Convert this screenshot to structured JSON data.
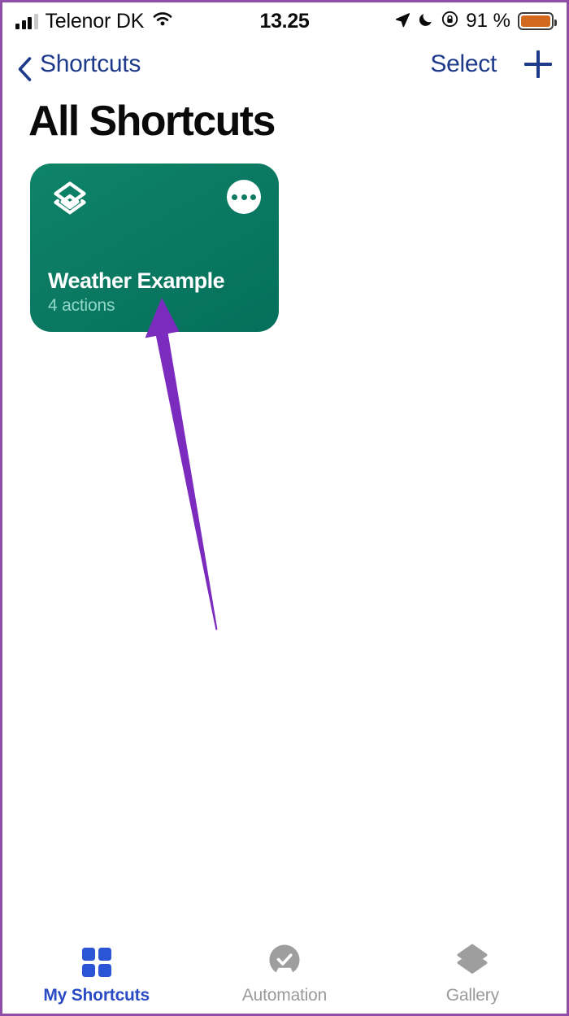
{
  "status_bar": {
    "carrier": "Telenor DK",
    "signal_icon": "cellular-signal-icon",
    "signal_bars_filled": 3,
    "signal_bars_total": 4,
    "wifi_icon": "wifi-icon",
    "time": "13.25",
    "location_icon": "location-arrow-icon",
    "dnd_icon": "moon-do-not-disturb-icon",
    "orientation_lock_icon": "rotation-lock-icon",
    "battery_percent": "91 %",
    "battery_icon": "battery-icon",
    "battery_fill_color": "#d2691e"
  },
  "nav_bar": {
    "back_icon": "chevron-left-icon",
    "back_label": "Shortcuts",
    "select_label": "Select",
    "add_icon": "plus-icon",
    "tint_color": "#1e3a8a"
  },
  "page": {
    "title": "All Shortcuts"
  },
  "shortcuts": [
    {
      "title": "Weather Example",
      "subtitle": "4 actions",
      "glyph_icon": "stacked-layers-icon",
      "more_icon": "ellipsis-icon",
      "color_start": "#0d8468",
      "color_end": "#04705b"
    }
  ],
  "annotation": {
    "type": "arrow",
    "color": "#7b2cbf",
    "points_to": "Weather Example card"
  },
  "tab_bar": {
    "tabs": [
      {
        "label": "My Shortcuts",
        "icon": "grid-2x2-icon",
        "active": true,
        "color": "#2a56d6"
      },
      {
        "label": "Automation",
        "icon": "checkmark-circle-icon",
        "active": false,
        "color": "#9a9a9a"
      },
      {
        "label": "Gallery",
        "icon": "stacked-layers-filled-icon",
        "active": false,
        "color": "#9a9a9a"
      }
    ]
  }
}
